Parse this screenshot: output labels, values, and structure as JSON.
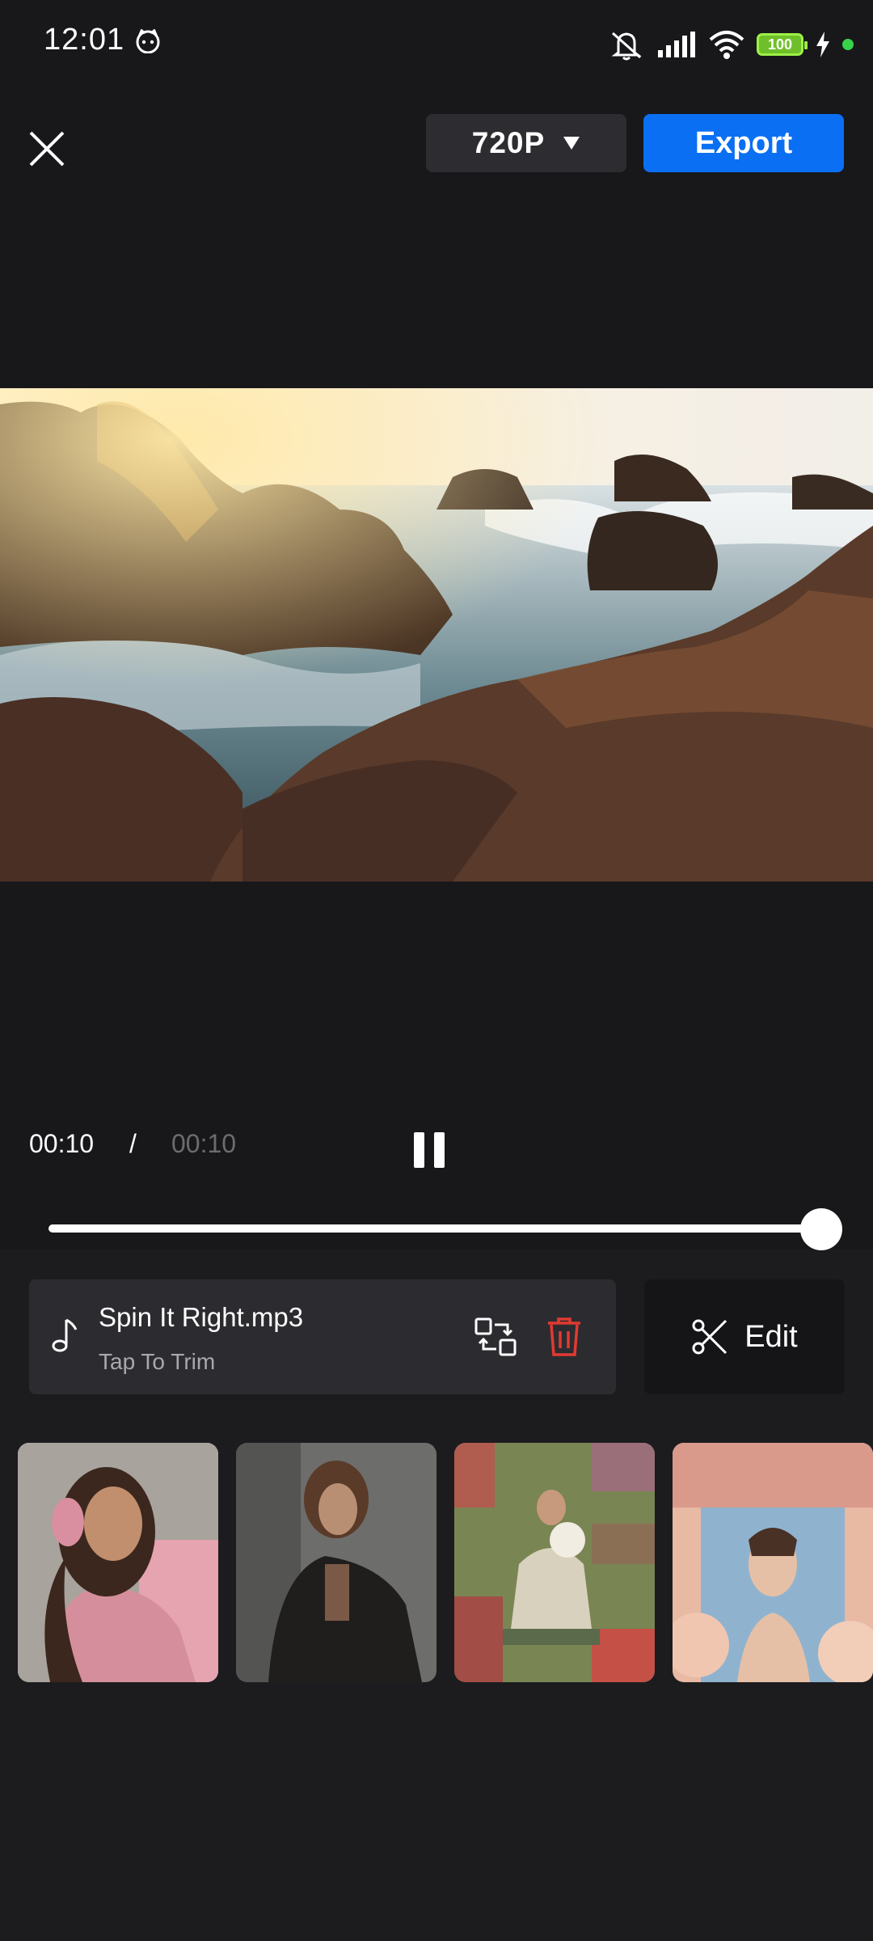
{
  "status_bar": {
    "time": "12:01",
    "battery": "100",
    "icons": [
      "cat-face-icon",
      "mute-icon",
      "signal-icon",
      "wifi-icon",
      "battery-icon",
      "charging-icon",
      "green-dot-icon"
    ]
  },
  "top_bar": {
    "resolution": "720P",
    "export_label": "Export"
  },
  "playback": {
    "current_time": "00:10",
    "separator": "/",
    "total_time": "00:10",
    "progress": 1.0
  },
  "music": {
    "title": "Spin It Right.mp3",
    "subtitle": "Tap To Trim"
  },
  "edit": {
    "label": "Edit"
  },
  "colors": {
    "accent": "#0a6ff3",
    "delete": "#e23a32",
    "background": "#1c1c1f"
  },
  "thumbnails": {
    "count": 4,
    "selected_index": 0
  }
}
